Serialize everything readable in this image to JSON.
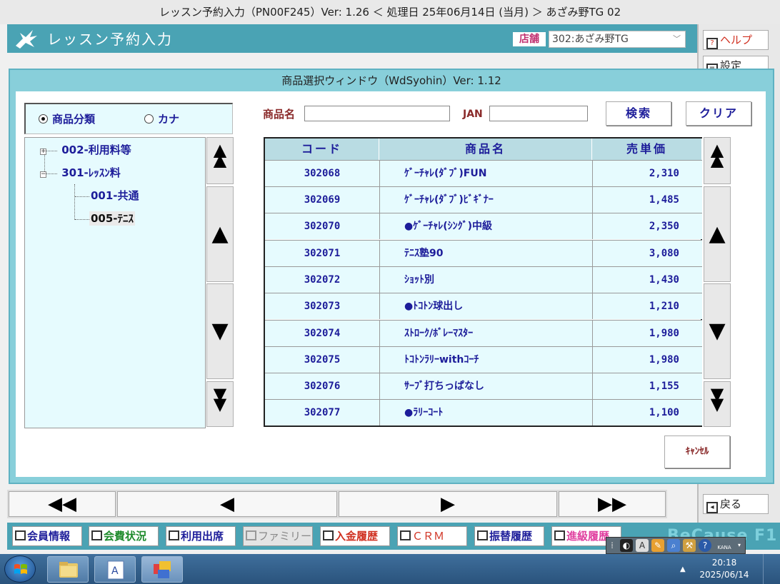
{
  "window": {
    "title": "レッスン予約入力（PN00F245）Ver: 1.26 ＜ 処理日 25年06月14日 (当月) ＞ あざみ野TG 02"
  },
  "header": {
    "title": "レッスン予約入力",
    "store_label": "店舗",
    "store_value": "302:あざみ野TG"
  },
  "side": {
    "help_label": "ヘルプ",
    "settings_label": "設定",
    "back_label": "戻る"
  },
  "dialog": {
    "title": "商品選択ウィンドウ（WdSyohin）Ver: 1.12",
    "radio_category": "商品分類",
    "radio_kana": "カナ",
    "selected_radio": "category",
    "name_label": "商品名",
    "name_value": "",
    "jan_label": "JAN",
    "jan_value": "",
    "search_label": "検索",
    "clear_label": "クリア",
    "cancel_label": "ｷｬﾝｾﾙ",
    "tree": [
      {
        "label": "002-利用料等",
        "toggle": "+"
      },
      {
        "label": "301-ﾚｯｽﾝ料",
        "toggle": "−"
      },
      {
        "label": "001-共通",
        "toggle": ""
      },
      {
        "label": "005-ﾃﾆｽ",
        "toggle": ""
      }
    ],
    "columns": [
      "コード",
      "商品名",
      "売単価"
    ],
    "rows": [
      {
        "code": "302068",
        "name": "ｹﾞｰﾁｬﾚ(ﾀﾞﾌﾞ)FUN",
        "price": "2,310"
      },
      {
        "code": "302069",
        "name": "ｹﾞｰﾁｬﾚ(ﾀﾞﾌﾞ)ﾋﾞｷﾞﾅｰ",
        "price": "1,485"
      },
      {
        "code": "302070",
        "name": "●ｹﾞｰﾁｬﾚ(ｼﾝｸﾞ)中級",
        "price": "2,350"
      },
      {
        "code": "302071",
        "name": "ﾃﾆｽ塾90",
        "price": "3,080"
      },
      {
        "code": "302072",
        "name": "ｼｮｯﾄ別",
        "price": "1,430"
      },
      {
        "code": "302073",
        "name": "●ﾄｺﾄﾝ球出し",
        "price": "1,210"
      },
      {
        "code": "302074",
        "name": "ｽﾄﾛｰｸ/ﾎﾞﾚｰﾏｽﾀｰ",
        "price": "1,980"
      },
      {
        "code": "302075",
        "name": "ﾄｺﾄﾝﾗﾘｰwithｺｰﾁ",
        "price": "1,980"
      },
      {
        "code": "302076",
        "name": "ｻｰﾌﾞ打ちっぱなし",
        "price": "1,155"
      },
      {
        "code": "302077",
        "name": "●ﾗﾘｰｺｰﾄ",
        "price": "1,100"
      }
    ]
  },
  "func_buttons": [
    {
      "label": "会員情報",
      "color": "#1d1d9a",
      "disabled": false
    },
    {
      "label": "会費状況",
      "color": "#1d8a2a",
      "disabled": false
    },
    {
      "label": "利用出席",
      "color": "#1d1d9a",
      "disabled": false
    },
    {
      "label": "ファミリー",
      "color": "#888888",
      "disabled": true
    },
    {
      "label": "入金履歴",
      "color": "#d03020",
      "disabled": false
    },
    {
      "label": "ＣＲＭ",
      "color": "#d03020",
      "disabled": false
    },
    {
      "label": "振替履歴",
      "color": "#1d1d9a",
      "disabled": false
    },
    {
      "label": "進級履歴",
      "color": "#e040a0",
      "disabled": false
    }
  ],
  "brand": "BeCause F1",
  "ime": {
    "mode_label": "KANA"
  },
  "taskbar": {
    "time": "20:18",
    "date": "2025/06/14"
  },
  "colors": {
    "accent": "#4aa3b4",
    "dialog": "#88cfda",
    "text_blue": "#1d1d9a",
    "cell_bg": "#e6fbfe"
  }
}
